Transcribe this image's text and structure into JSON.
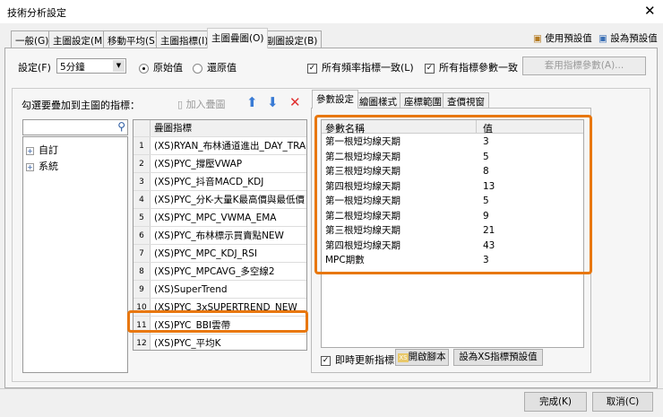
{
  "window": {
    "title": "技術分析設定",
    "close": "✕"
  },
  "tabs": [
    "一般(G)",
    "主圖設定(M)",
    "移動平均(S)",
    "主圖指標(I)",
    "主圖疊圖(O)",
    "副圖設定(B)"
  ],
  "header_actions": {
    "use_default": "使用預設值",
    "set_default": "設為預設值"
  },
  "settings": {
    "label": "設定(F)",
    "period": "5分鐘",
    "radio_original": "原始值",
    "radio_restore": "還原值",
    "all_freq": "所有頻率指標一致(L)",
    "all_params": "所有指標參數一致",
    "apply_params": "套用指標參數(A)..."
  },
  "left": {
    "label": "勾選要疊加到主圖的指標：",
    "tree": [
      "自訂",
      "系統"
    ]
  },
  "toolbar": {
    "add_overlay": "加入疊圖"
  },
  "overlay_table": {
    "header": "疊圖指標",
    "rows": [
      {
        "n": "1",
        "name": "(XS)RYAN_布林通道進出_DAY_TRADE"
      },
      {
        "n": "2",
        "name": "(XS)PYC_撐壓VWAP"
      },
      {
        "n": "3",
        "name": "(XS)PYC_抖音MACD_KDJ"
      },
      {
        "n": "4",
        "name": "(XS)PYC_分K-大量K最高價與最低價"
      },
      {
        "n": "5",
        "name": "(XS)PYC_MPC_VWMA_EMA"
      },
      {
        "n": "6",
        "name": "(XS)PYC_布林標示買賣點NEW"
      },
      {
        "n": "7",
        "name": "(XS)PYC_MPC_KDJ_RSI"
      },
      {
        "n": "8",
        "name": "(XS)PYC_MPCAVG_多空線2"
      },
      {
        "n": "9",
        "name": "(XS)SuperTrend"
      },
      {
        "n": "10",
        "name": "(XS)PYC_3xSUPERTREND_NEW"
      },
      {
        "n": "11",
        "name": "(XS)PYC_BBI雲帶"
      },
      {
        "n": "12",
        "name": "(XS)PYC_平均K"
      }
    ]
  },
  "right_tabs": [
    "參數設定",
    "繪圖樣式",
    "座標範圍",
    "查價視窗"
  ],
  "params": {
    "col_name": "參數名稱",
    "col_value": "值",
    "rows": [
      {
        "name": "第一根短均線天期",
        "value": "3"
      },
      {
        "name": "第二根短均線天期",
        "value": "5"
      },
      {
        "name": "第三根短均線天期",
        "value": "8"
      },
      {
        "name": "第四根短均線天期",
        "value": "13"
      },
      {
        "name": "第一根短均線天期",
        "value": "5"
      },
      {
        "name": "第二根短均線天期",
        "value": "9"
      },
      {
        "name": "第三根短均線天期",
        "value": "21"
      },
      {
        "name": "第四根短均線天期",
        "value": "43"
      },
      {
        "name": "MPC期數",
        "value": "3"
      }
    ]
  },
  "bottom": {
    "realtime": "即時更新指標",
    "open_script": "開啟腳本",
    "set_xs_default": "設為XS指標預設值"
  },
  "footer": {
    "ok": "完成(K)",
    "cancel": "取消(C)"
  },
  "colors": {
    "highlight": "#e8770e"
  }
}
